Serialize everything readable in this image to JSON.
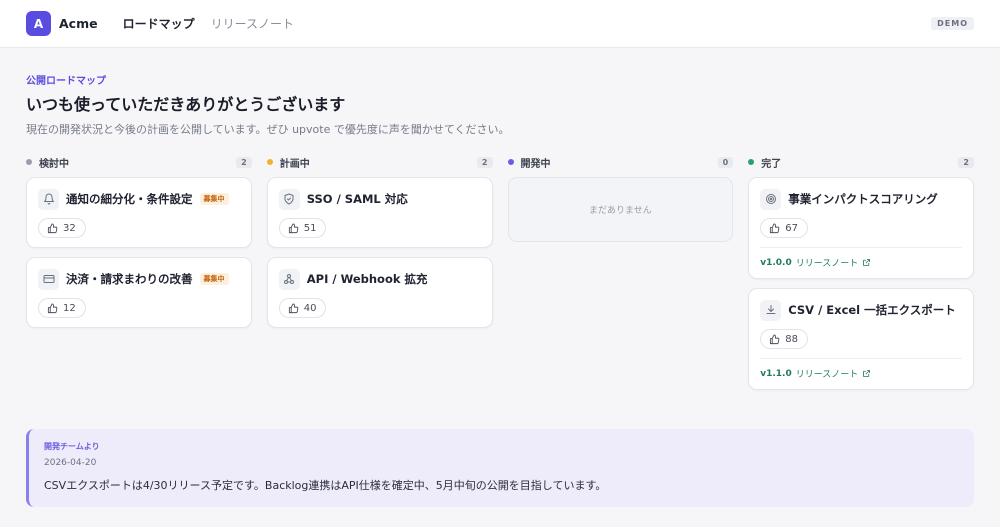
{
  "header": {
    "logo_letter": "A",
    "brand": "Acme",
    "nav": [
      {
        "label": "ロードマップ",
        "active": true
      },
      {
        "label": "リリースノート",
        "active": false
      }
    ],
    "badge": "DEMO"
  },
  "intro": {
    "eyebrow": "公開ロードマップ",
    "title": "いつも使っていただきありがとうございます",
    "description": "現在の開発状況と今後の計画を公開しています。ぜひ upvote で優先度に声を聞かせてください。"
  },
  "columns": [
    {
      "title": "検討中",
      "count": "2",
      "color": "#9a9ea9",
      "cards": [
        {
          "icon": "bell-icon",
          "title": "通知の細分化・条件設定",
          "badge": "募集中",
          "votes": "32"
        },
        {
          "icon": "credit-card-icon",
          "title": "決済・請求まわりの改善",
          "badge": "募集中",
          "votes": "12"
        }
      ]
    },
    {
      "title": "計画中",
      "count": "2",
      "color": "#f0b429",
      "cards": [
        {
          "icon": "shield-icon",
          "title": "SSO / SAML 対応",
          "votes": "51"
        },
        {
          "icon": "webhook-icon",
          "title": "API / Webhook 拡充",
          "votes": "40"
        }
      ]
    },
    {
      "title": "開発中",
      "count": "0",
      "color": "#6a5ee0",
      "empty_text": "まだありません"
    },
    {
      "title": "完了",
      "count": "2",
      "color": "#2f9e6e",
      "cards": [
        {
          "icon": "target-icon",
          "title": "事業インパクトスコアリング",
          "votes": "67",
          "version": "v1.0.0",
          "release_label": "リリースノート"
        },
        {
          "icon": "download-icon",
          "title": "CSV / Excel 一括エクスポート",
          "votes": "88",
          "version": "v1.1.0",
          "release_label": "リリースノート"
        }
      ]
    }
  ],
  "team_note": {
    "label": "開発チームより",
    "date": "2026-04-20",
    "body": "CSVエクスポートは4/30リリース予定です。Backlog連携はAPI仕様を確定中、5月中旬の公開を目指しています。"
  }
}
